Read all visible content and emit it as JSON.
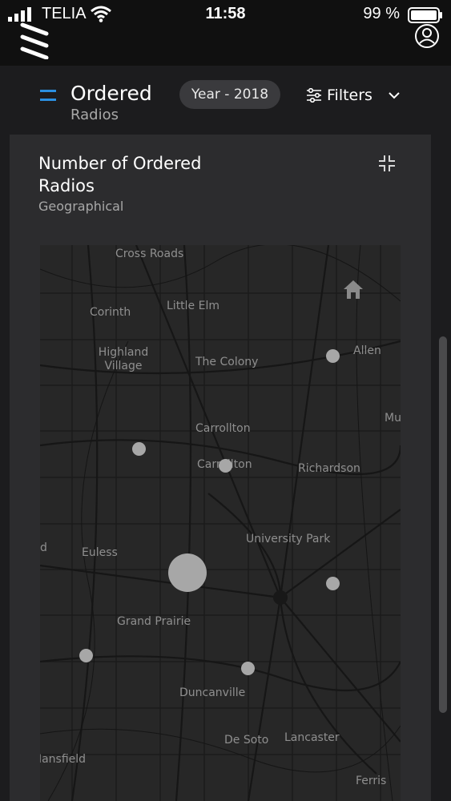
{
  "status_bar": {
    "carrier": "TELIA",
    "time": "11:58",
    "battery": "99 %"
  },
  "header": {
    "title": "Ordered",
    "subtitle": "Radios",
    "year_filter": "Year - 2018",
    "filters_label": "Filters"
  },
  "card": {
    "title": "Number of Ordered Radios",
    "subtitle": "Geographical"
  },
  "map": {
    "places": {
      "cross_roads": "Cross Roads",
      "corinth": "Corinth",
      "little_elm": "Little Elm",
      "highland_village": "Highland Village",
      "the_colony": "The Colony",
      "allen": "Allen",
      "mu": "Mu",
      "carrollton_1": "Carrollton",
      "carrollton_2": "Carrollton",
      "richardson": "Richardson",
      "d": "d",
      "euless": "Euless",
      "university_park": "University Park",
      "grand_prairie": "Grand Prairie",
      "duncanville": "Duncanville",
      "de_soto": "De Soto",
      "lancaster": "Lancaster",
      "mansfield": "Mansfield",
      "ferris": "Ferris"
    },
    "markers": [
      {
        "near": "Allen",
        "size": "small"
      },
      {
        "near": "Carrollton",
        "size": "small"
      },
      {
        "near": "Carrollton",
        "size": "small"
      },
      {
        "near": "Euless",
        "size": "large"
      },
      {
        "near": "University Park",
        "size": "small"
      },
      {
        "near": "Grand Prairie",
        "size": "small"
      },
      {
        "near": "Duncanville",
        "size": "small"
      }
    ],
    "marker_color": "#a7a7a7"
  },
  "colors": {
    "accent": "#2b8fe0",
    "background": "#1c1c1e",
    "card": "#2c2c2e"
  },
  "icons": [
    "signal-icon",
    "wifi-icon",
    "battery-icon",
    "brand-icon",
    "profile-icon",
    "menu-icon",
    "filter-icon",
    "chevron-down-icon",
    "collapse-icon",
    "home-icon"
  ]
}
